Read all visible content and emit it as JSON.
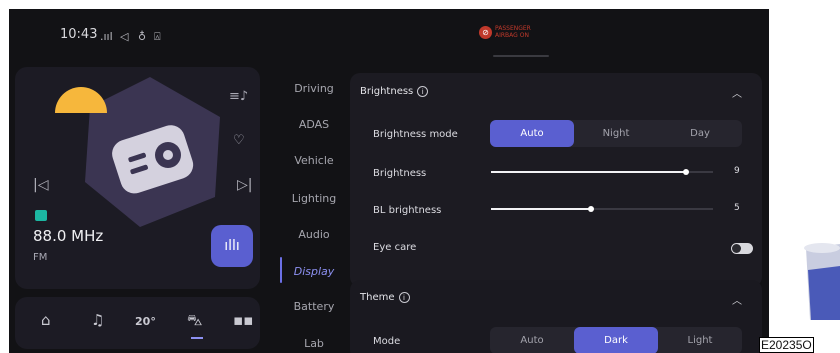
{
  "status_bar": {
    "time": "10:43",
    "icons": [
      "signal-icon",
      "navigation-icon",
      "mic-icon",
      "lock-icon"
    ],
    "airbag_line1": "PASSENGER",
    "airbag_line2": "AIRBAG",
    "airbag_state": "ON"
  },
  "media": {
    "frequency": "88.0 MHz",
    "band": "FM"
  },
  "nav": {
    "temperature": "20",
    "temperature_unit": "°",
    "active": "car"
  },
  "menu": {
    "items": [
      "Driving",
      "ADAS",
      "Vehicle",
      "Lighting",
      "Audio",
      "Display",
      "Battery",
      "Lab"
    ],
    "active": "Display"
  },
  "brightness_panel": {
    "title": "Brightness",
    "mode_label": "Brightness mode",
    "mode_options": [
      "Auto",
      "Night",
      "Day"
    ],
    "mode_selected": "Auto",
    "brightness_label": "Brightness",
    "brightness_value": "9",
    "brightness_level": 0.88,
    "bl_label": "BL brightness",
    "bl_value": "5",
    "bl_level": 0.45,
    "eye_care_label": "Eye care",
    "eye_care_on": false
  },
  "theme_panel": {
    "title": "Theme",
    "mode_label": "Mode",
    "mode_options": [
      "Auto",
      "Dark",
      "Light"
    ],
    "mode_selected": "Dark"
  },
  "figure_id": "E20235O",
  "colors": {
    "accent": "#5a5fd0",
    "background": "#121215",
    "card": "#1c1b24"
  }
}
